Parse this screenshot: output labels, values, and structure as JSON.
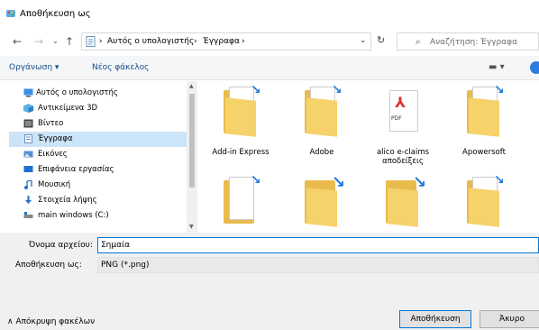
{
  "window": {
    "title": "Αποθήκευση ως"
  },
  "address": {
    "crumbs": [
      "Αυτός ο υπολογιστής",
      "Έγγραφα"
    ],
    "separator": "›",
    "search_placeholder": "Αναζήτηση: Έγγραφα"
  },
  "toolbar": {
    "organize": "Οργάνωση ▾",
    "new_folder": "Νέος φάκελος"
  },
  "nav": {
    "items": [
      {
        "label": "Αυτός ο υπολογιστής",
        "icon": "computer-icon"
      },
      {
        "label": "Αντικείμενα 3D",
        "icon": "cube-icon"
      },
      {
        "label": "Βίντεο",
        "icon": "video-icon"
      },
      {
        "label": "Έγγραφα",
        "icon": "documents-icon",
        "selected": true
      },
      {
        "label": "Εικόνες",
        "icon": "pictures-icon"
      },
      {
        "label": "Επιφάνεια εργασίας",
        "icon": "desktop-icon"
      },
      {
        "label": "Μουσική",
        "icon": "music-icon"
      },
      {
        "label": "Στοιχεία λήψης",
        "icon": "download-icon"
      },
      {
        "label": "main windows (C:)",
        "icon": "drive-icon"
      }
    ]
  },
  "files": [
    {
      "label": "Add-in Express",
      "kind": "folder"
    },
    {
      "label": "Adobe",
      "kind": "folder"
    },
    {
      "label": "alico e-claims αποδείξεις",
      "kind": "pdf"
    },
    {
      "label": "Apowersoft",
      "kind": "folder"
    },
    {
      "label": "",
      "kind": "folder-doc"
    },
    {
      "label": "",
      "kind": "folder"
    },
    {
      "label": "",
      "kind": "folder"
    },
    {
      "label": "",
      "kind": "folder-pdf"
    }
  ],
  "form": {
    "filename_label": "Όνομα αρχείου:",
    "filename_value": "Σημαία",
    "filetype_label": "Αποθήκευση ως:",
    "filetype_value": "PNG (*.png)",
    "hide_folders": "∧  Απόκρυψη φακέλων",
    "save": "Αποθήκευση",
    "cancel": "Άκυρο"
  },
  "colors": {
    "accent": "#0078d7",
    "folder": "#f6d26b",
    "selection": "#cce4f7"
  }
}
